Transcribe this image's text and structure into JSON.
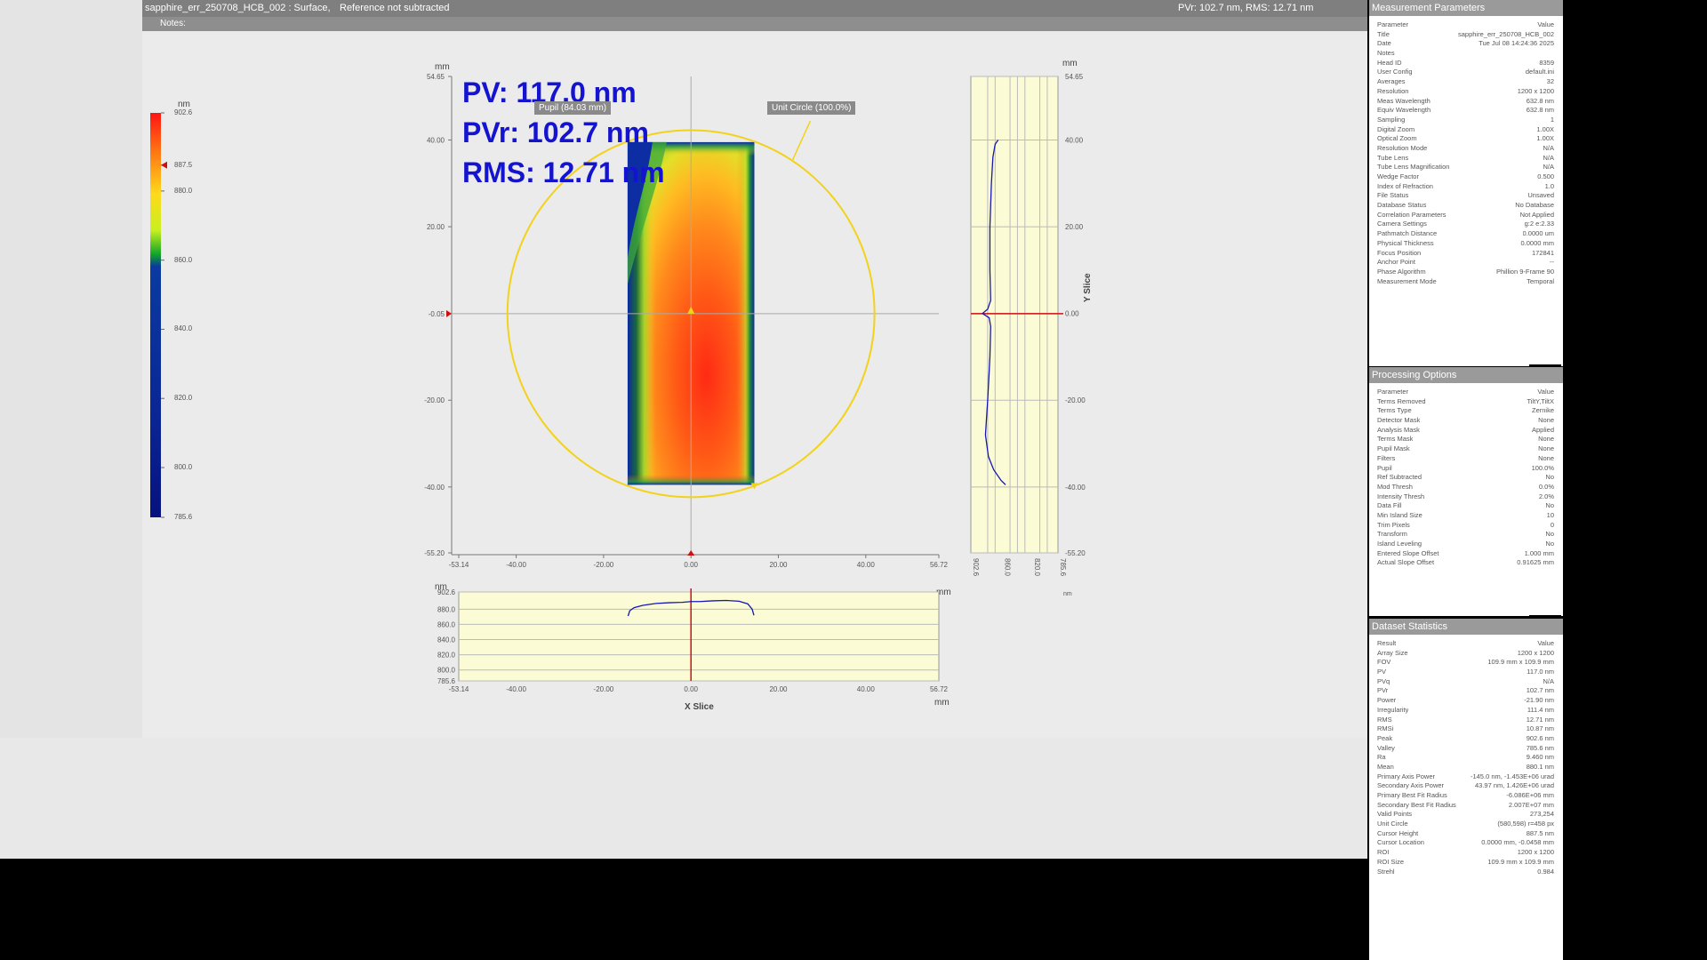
{
  "title_bar": {
    "left": "sapphire_err_250708_HCB_002 : Surface,",
    "reference": "Reference not subtracted",
    "right": "PVr: 102.7 nm, RMS: 12.71 nm"
  },
  "notes_bar": {
    "label": "Notes:"
  },
  "stats_overlay": {
    "pv": "PV: 117.0 nm",
    "pvr": "PVr: 102.7 nm",
    "rms": "RMS: 12.71 nm"
  },
  "tags": {
    "pupil": "Pupil (84.03 mm)",
    "unit_circle": "Unit Circle (100.0%)"
  },
  "colorbar": {
    "unit": "nm",
    "labels": [
      "902.6",
      "887.5",
      "880.0",
      "860.0",
      "840.0",
      "820.0",
      "800.0",
      "785.6"
    ],
    "values": [
      902.6,
      887.5,
      880.0,
      860.0,
      840.0,
      820.0,
      800.0,
      785.6
    ],
    "range": [
      785.6,
      902.6
    ],
    "cursor_value": 887.5
  },
  "main_map": {
    "x_unit": "mm",
    "y_unit": "mm",
    "x_ticks": [
      "-53.14",
      "-40.00",
      "-20.00",
      "0.00",
      "20.00",
      "40.00",
      "56.72"
    ],
    "x_tick_values": [
      -53.14,
      -40,
      -20,
      0,
      20,
      40,
      56.72
    ],
    "y_ticks": [
      "54.65",
      "40.00",
      "20.00",
      "-0.05",
      "-20.00",
      "-40.00",
      "-55.20"
    ],
    "y_tick_values": [
      54.65,
      40,
      20,
      -0.05,
      -20,
      -40,
      -55.2
    ],
    "x_range": [
      -53.14,
      56.72
    ],
    "y_range": [
      -55.2,
      54.65
    ],
    "aperture_x_mm": [
      -14.5,
      14.5
    ],
    "aperture_y_mm": [
      -39.5,
      39.5
    ],
    "unit_circle_radius_mm": 42.0,
    "cursor": [
      0,
      -0.05
    ]
  },
  "x_slice": {
    "label": "X Slice",
    "x_unit": "mm",
    "y_unit": "nm",
    "y_ticks": [
      "902.6",
      "880.0",
      "860.0",
      "840.0",
      "820.0",
      "800.0",
      "785.6"
    ],
    "y_tick_values": [
      902.6,
      880,
      860,
      840,
      820,
      800,
      785.6
    ],
    "x_ticks": [
      "-53.14",
      "-40.00",
      "-20.00",
      "0.00",
      "20.00",
      "40.00",
      "56.72"
    ],
    "x_tick_values": [
      -53.14,
      -40,
      -20,
      0,
      20,
      40,
      56.72
    ],
    "x_range": [
      -53.14,
      56.72
    ],
    "y_range": [
      785.6,
      902.6
    ],
    "profile": [
      [
        -14.4,
        871
      ],
      [
        -14,
        878
      ],
      [
        -13,
        882
      ],
      [
        -11,
        885
      ],
      [
        -8,
        887.5
      ],
      [
        -5,
        888.5
      ],
      [
        -2,
        889
      ],
      [
        0,
        890
      ],
      [
        2,
        890
      ],
      [
        5,
        891
      ],
      [
        8,
        891.5
      ],
      [
        11,
        890.5
      ],
      [
        13,
        887
      ],
      [
        14,
        880
      ],
      [
        14.4,
        872
      ]
    ]
  },
  "y_slice": {
    "label": "Y Slice",
    "y_unit": "mm",
    "x_unit": "nm",
    "y_ticks": [
      "54.65",
      "40.00",
      "20.00",
      "0.00",
      "-20.00",
      "-40.00",
      "-55.20"
    ],
    "y_tick_values": [
      54.65,
      40,
      20,
      0,
      -20,
      -40,
      -55.2
    ],
    "x_ticks": [
      "902.6",
      "860.0",
      "820.0",
      "785.6"
    ],
    "x_tick_values": [
      902.6,
      860,
      820,
      785.6
    ],
    "x_range": [
      902.6,
      785.6
    ],
    "y_range": [
      -55.2,
      54.65
    ],
    "profile": [
      [
        40,
        866
      ],
      [
        39,
        870
      ],
      [
        36,
        873
      ],
      [
        30,
        875
      ],
      [
        20,
        877
      ],
      [
        10,
        877
      ],
      [
        3,
        876
      ],
      [
        1,
        880
      ],
      [
        0,
        887
      ],
      [
        -1,
        878
      ],
      [
        -3,
        876
      ],
      [
        -10,
        877
      ],
      [
        -20,
        880
      ],
      [
        -28,
        883
      ],
      [
        -33,
        879
      ],
      [
        -36,
        872
      ],
      [
        -38.5,
        862
      ],
      [
        -39.5,
        856
      ]
    ]
  },
  "measurement_parameters": {
    "title": "Measurement Parameters",
    "header": [
      "Parameter",
      "Value"
    ],
    "rows": [
      [
        "Title",
        "sapphire_err_250708_HCB_002"
      ],
      [
        "Date",
        "Tue Jul 08 14:24:36 2025"
      ],
      [
        "Notes",
        ""
      ],
      [
        "Head ID",
        "8359"
      ],
      [
        "User Config",
        "default.ini"
      ],
      [
        "Averages",
        "32"
      ],
      [
        "Resolution",
        "1200 x 1200"
      ],
      [
        "Meas Wavelength",
        "632.8 nm"
      ],
      [
        "Equiv Wavelength",
        "632.8 nm"
      ],
      [
        "Sampling",
        "1"
      ],
      [
        "Digital Zoom",
        "1.00X"
      ],
      [
        "Optical Zoom",
        "1.00X"
      ],
      [
        "Resolution Mode",
        "N/A"
      ],
      [
        "Tube Lens",
        "N/A"
      ],
      [
        "Tube Lens Magnification",
        "N/A"
      ],
      [
        "Wedge Factor",
        "0.500"
      ],
      [
        "Index of Refraction",
        "1.0"
      ],
      [
        "File Status",
        "Unsaved"
      ],
      [
        "Database Status",
        "No Database"
      ],
      [
        "Correlation Parameters",
        "Not Applied"
      ],
      [
        "Camera Settings",
        "g:2 e:2.33"
      ],
      [
        "Pathmatch Distance",
        "0.0000 um"
      ],
      [
        "Physical Thickness",
        "0.0000 mm"
      ],
      [
        "Focus Position",
        "172841"
      ],
      [
        "Anchor Point",
        "--"
      ],
      [
        "Phase Algorithm",
        "Phillion 9-Frame 90"
      ],
      [
        "Measurement Mode",
        "Temporal"
      ]
    ]
  },
  "processing_options": {
    "title": "Processing Options",
    "header": [
      "Parameter",
      "Value"
    ],
    "rows": [
      [
        "Terms Removed",
        "TiltY,TiltX"
      ],
      [
        "Terms Type",
        "Zernike"
      ],
      [
        "Detector Mask",
        "None"
      ],
      [
        "Analysis Mask",
        "Applied"
      ],
      [
        "Terms Mask",
        "None"
      ],
      [
        "Pupil Mask",
        "None"
      ],
      [
        "Filters",
        "None"
      ],
      [
        "Pupil",
        "100.0%"
      ],
      [
        "Ref Subtracted",
        "No"
      ],
      [
        "Mod Thresh",
        "0.0%"
      ],
      [
        "Intensity Thresh",
        "2.0%"
      ],
      [
        "Data Fill",
        "No"
      ],
      [
        "Min Island Size",
        "10"
      ],
      [
        "Trim Pixels",
        "0"
      ],
      [
        "Transform",
        "No"
      ],
      [
        "Island Leveling",
        "No"
      ],
      [
        "Entered Slope Offset",
        "1.000 mm"
      ],
      [
        "Actual Slope Offset",
        "0.91625 mm"
      ]
    ]
  },
  "dataset_statistics": {
    "title": "Dataset Statistics",
    "header": [
      "Result",
      "Value"
    ],
    "rows": [
      [
        "Array Size",
        "1200 x 1200"
      ],
      [
        "FOV",
        "109.9 mm x 109.9 mm"
      ],
      [
        "PV",
        "117.0 nm"
      ],
      [
        "PVq",
        "N/A"
      ],
      [
        "PVr",
        "102.7 nm"
      ],
      [
        "Power",
        "-21.90 nm"
      ],
      [
        "Irregularity",
        "111.4 nm"
      ],
      [
        "RMS",
        "12.71 nm"
      ],
      [
        "RMSi",
        "10.87 nm"
      ],
      [
        "Peak",
        "902.6 nm"
      ],
      [
        "Valley",
        "785.6 nm"
      ],
      [
        "Ra",
        "9.460 nm"
      ],
      [
        "Mean",
        "880.1 nm"
      ],
      [
        "Primary Axis Power",
        "-145.0 nm, -1.453E+06 urad"
      ],
      [
        "Secondary Axis Power",
        "43.97 nm, 1.426E+06 urad"
      ],
      [
        "Primary Best Fit Radius",
        "-6.086E+06 mm"
      ],
      [
        "Secondary Best Fit Radius",
        "2.007E+07 mm"
      ],
      [
        "Valid Points",
        "273,254"
      ],
      [
        "Unit Circle",
        "(580,598) r=458 px"
      ],
      [
        "Cursor Height",
        "887.5 nm"
      ],
      [
        "Cursor Location",
        "0.0000 mm, -0.0458 mm"
      ],
      [
        "ROI",
        "1200 x 1200"
      ],
      [
        "ROI Size",
        "109.9 mm x 109.9 mm"
      ],
      [
        "Strehl",
        "0.984"
      ]
    ]
  },
  "colors": {
    "stat_text": "#1414d0",
    "unit_circle": "#f2d21a",
    "cursor": "#d01010",
    "slice_line": "#1616b0",
    "slice_bg": "#fbfbd6",
    "outside": "#000000"
  }
}
